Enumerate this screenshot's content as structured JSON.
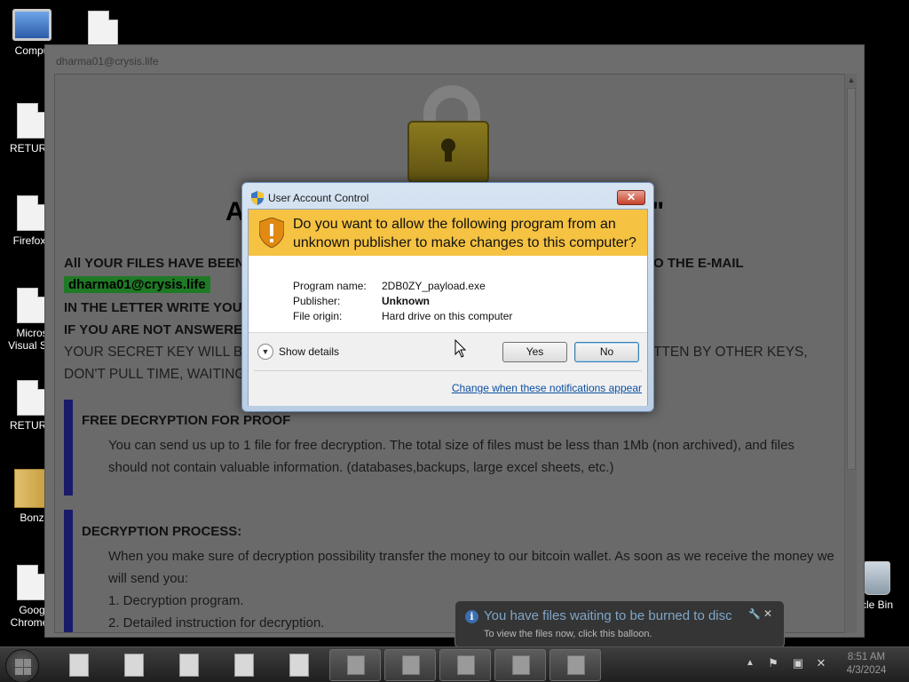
{
  "desktop_icons": [
    {
      "label": "Compu"
    },
    {
      "label": ""
    },
    {
      "label": "RETURN"
    },
    {
      "label": "Firefox.l"
    },
    {
      "label": "Micros"
    },
    {
      "label": "Visual Stu"
    },
    {
      "label": "RETURN"
    },
    {
      "label": "Bonz"
    },
    {
      "label": "Goog"
    },
    {
      "label": "Chrome.l"
    },
    {
      "label": "cle Bin"
    }
  ],
  "ransom_window": {
    "title": "dharma01@crysis.life",
    "heading_left": "A",
    "heading_right": "\"",
    "line1": "All YOUR FILES HAVE BEEN",
    "line1_right": "O THE E-MAIL",
    "email": "dharma01@crysis.life",
    "line2": "IN THE LETTER WRITE YOU",
    "line3": "IF YOU ARE NOT ANSWERE",
    "line4": "YOUR SECRET KEY WILL BE S",
    "line4_right": "TTEN BY OTHER KEYS,",
    "line5": "DON'T PULL TIME, WAITING",
    "sections": [
      {
        "title": "FREE DECRYPTION FOR PROOF",
        "lines": [
          "You can send us up to 1 file for free decryption. The total size of files must be less than 1Mb (non archived), and files",
          "should not contain valuable information. (databases,backups, large excel sheets, etc.)"
        ]
      },
      {
        "title": "DECRYPTION PROCESS:",
        "lines": [
          "When you make sure of decryption possibility transfer the money to our bitcoin wallet. As soon as we receive the money we",
          "will send you:",
          "1. Decryption program.",
          "2. Detailed instruction for decryption."
        ]
      }
    ]
  },
  "uac": {
    "title": "User Account Control",
    "close_label": "✕",
    "question": "Do you want to allow the following program from an unknown publisher to make changes to this computer?",
    "fields": [
      {
        "key": "Program name:",
        "value": "2DB0ZY_payload.exe"
      },
      {
        "key": "Publisher:",
        "value": "Unknown"
      },
      {
        "key": "File origin:",
        "value": "Hard drive on this computer"
      }
    ],
    "show_details": "Show details",
    "yes": "Yes",
    "no": "No",
    "notifications_link": "Change when these notifications appear"
  },
  "balloon": {
    "title": "You have files waiting to be burned to disc",
    "text": "To view the files now, click this balloon.",
    "close": "✕"
  },
  "taskbar": {
    "clock_time": "8:51 AM",
    "clock_date": "4/3/2024"
  },
  "colors": {
    "uac_banner": "#f5c242",
    "email_badge": "#1f7a25",
    "link": "#0a4fa3"
  }
}
